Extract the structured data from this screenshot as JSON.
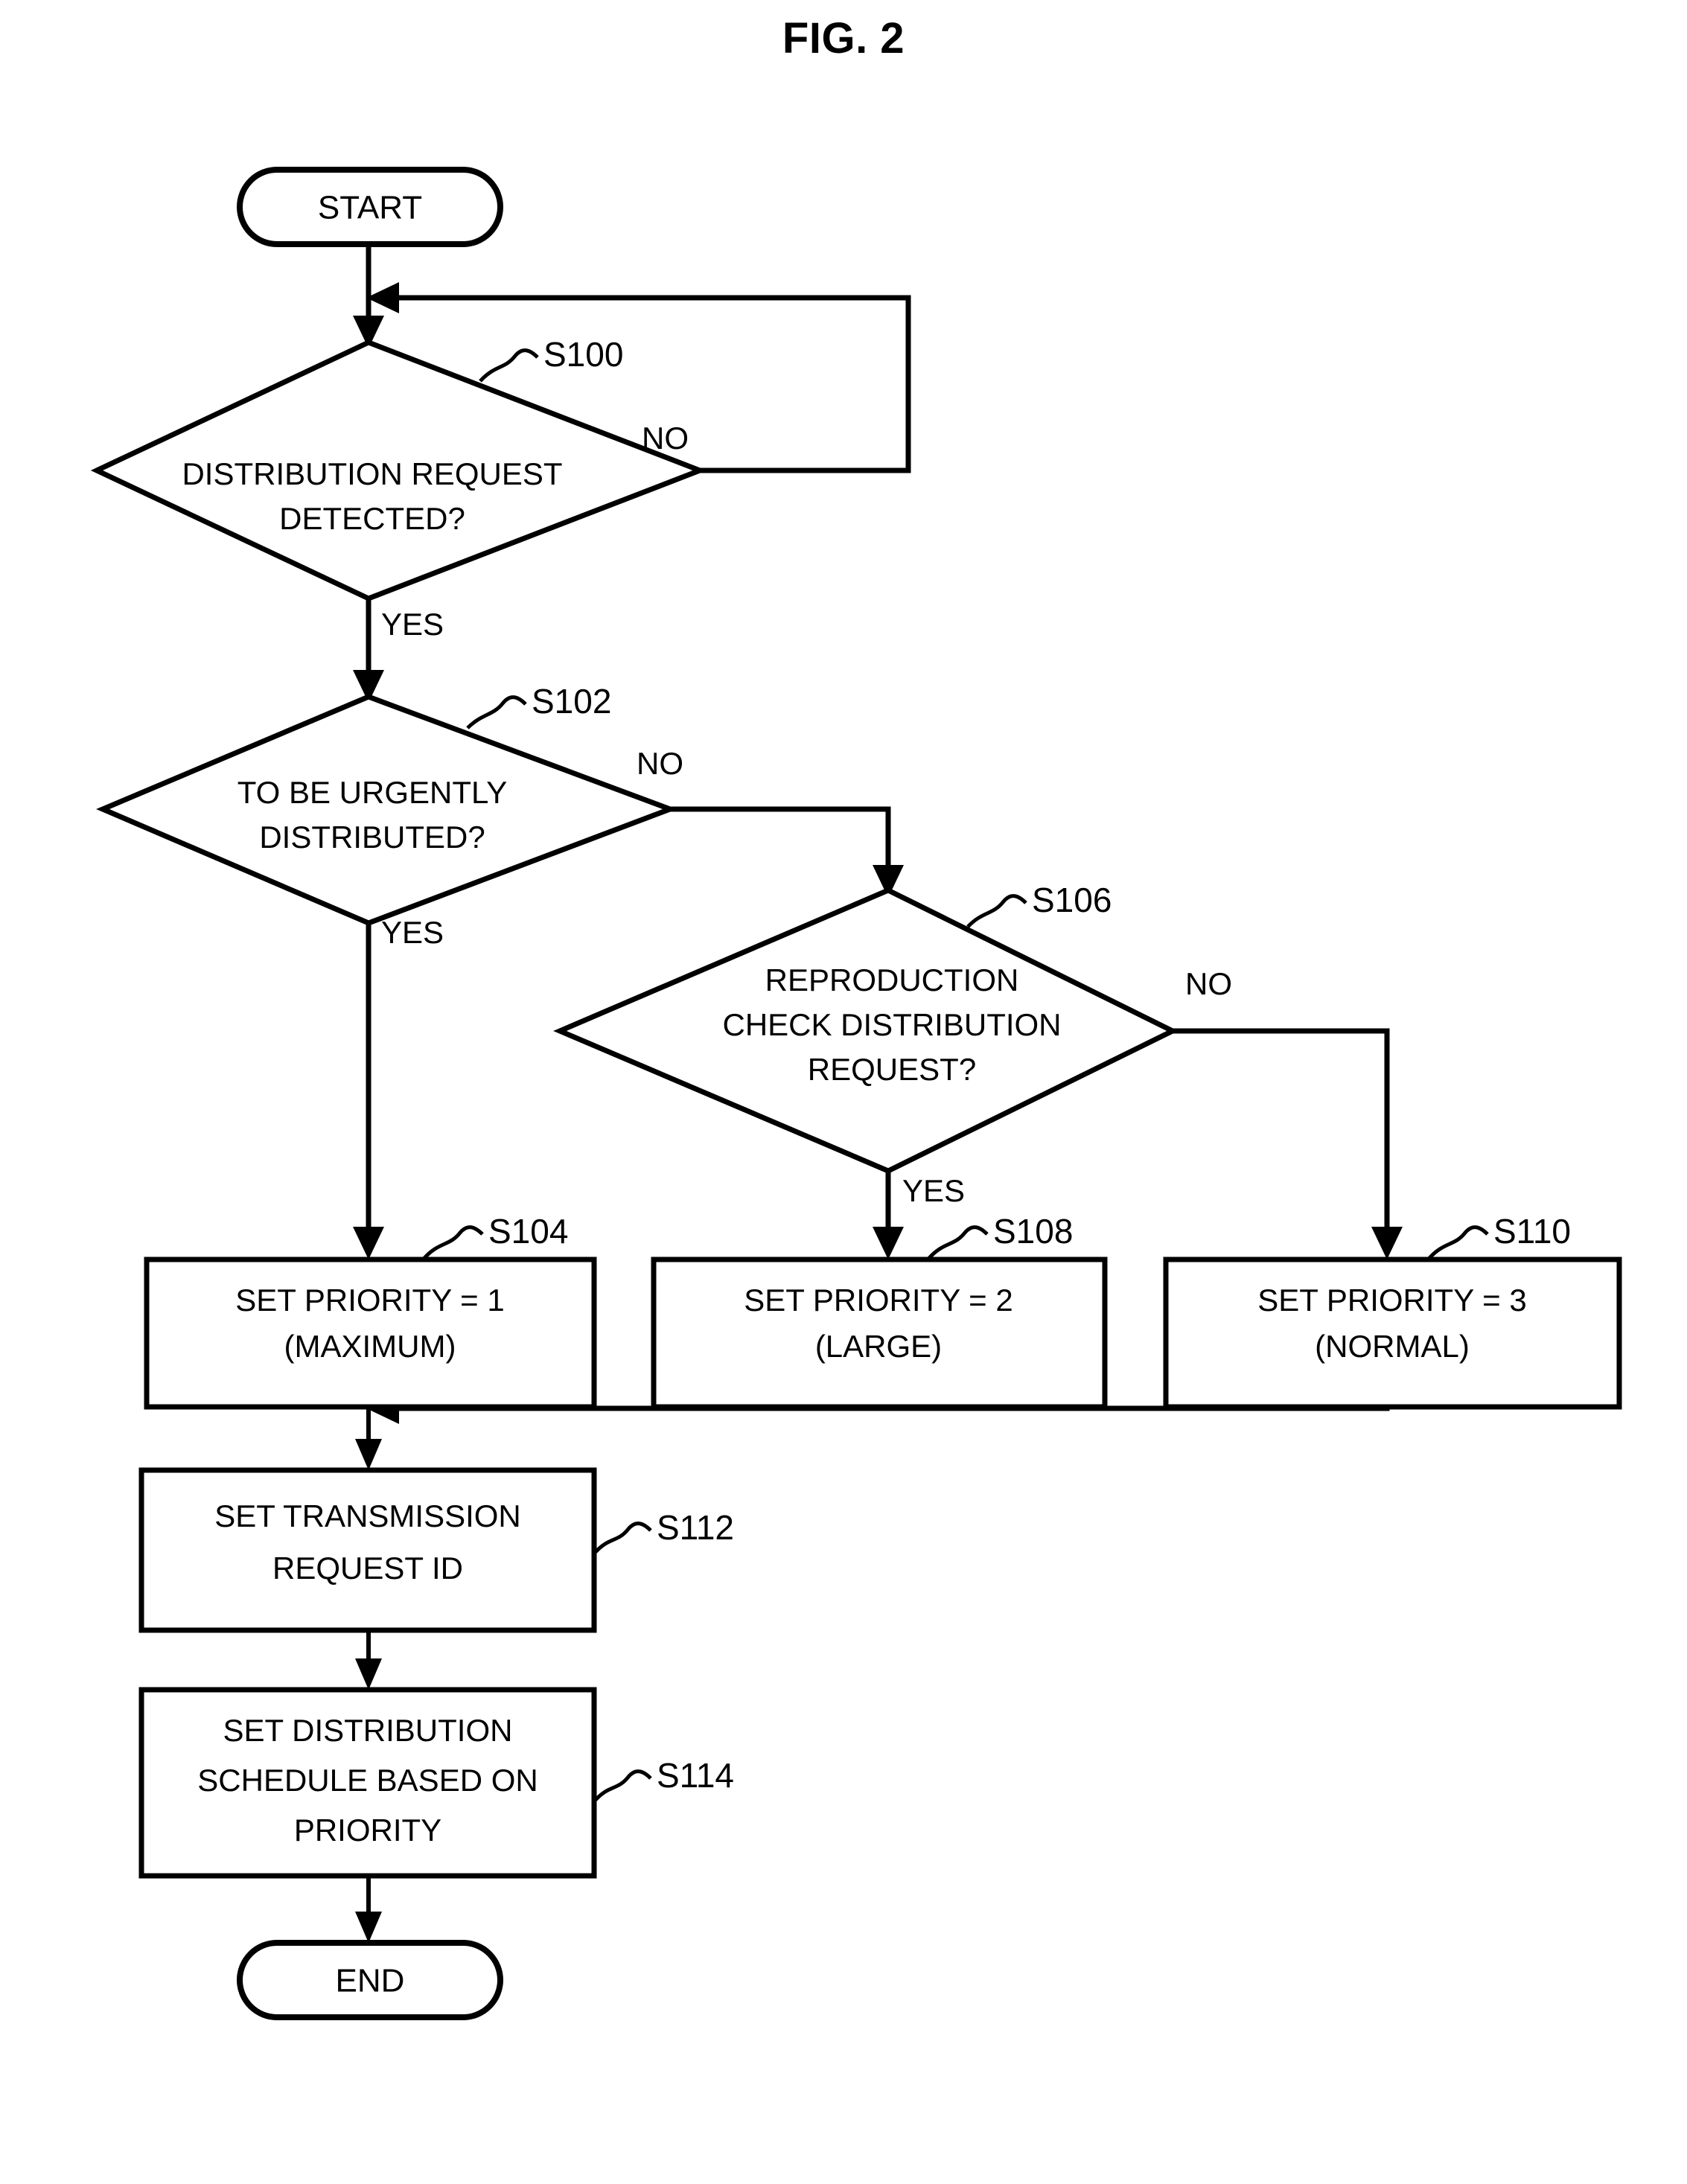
{
  "figure": {
    "title": "FIG. 2",
    "type": "flowchart"
  },
  "chart_data": {
    "type": "diagram",
    "title": "FIG. 2",
    "nodes": [
      {
        "id": "start",
        "shape": "terminator",
        "lines": [
          "START"
        ]
      },
      {
        "id": "s100",
        "shape": "decision",
        "step": "S100",
        "lines": [
          "DISTRIBUTION REQUEST",
          "DETECTED?"
        ]
      },
      {
        "id": "s102",
        "shape": "decision",
        "step": "S102",
        "lines": [
          "TO BE URGENTLY",
          "DISTRIBUTED?"
        ]
      },
      {
        "id": "s106",
        "shape": "decision",
        "step": "S106",
        "lines": [
          "REPRODUCTION",
          "CHECK DISTRIBUTION",
          "REQUEST?"
        ]
      },
      {
        "id": "s104",
        "shape": "process",
        "step": "S104",
        "lines": [
          "SET PRIORITY = 1",
          "(MAXIMUM)"
        ]
      },
      {
        "id": "s108",
        "shape": "process",
        "step": "S108",
        "lines": [
          "SET PRIORITY = 2",
          "(LARGE)"
        ]
      },
      {
        "id": "s110",
        "shape": "process",
        "step": "S110",
        "lines": [
          "SET PRIORITY = 3",
          "(NORMAL)"
        ]
      },
      {
        "id": "s112",
        "shape": "process",
        "step": "S112",
        "lines": [
          "SET TRANSMISSION",
          "REQUEST ID"
        ]
      },
      {
        "id": "s114",
        "shape": "process",
        "step": "S114",
        "lines": [
          "SET DISTRIBUTION",
          "SCHEDULE BASED ON",
          "PRIORITY"
        ]
      },
      {
        "id": "end",
        "shape": "terminator",
        "lines": [
          "END"
        ]
      }
    ],
    "edges": [
      {
        "from": "start",
        "to": "s100",
        "label": ""
      },
      {
        "from": "s100",
        "to": "s100",
        "label": "NO"
      },
      {
        "from": "s100",
        "to": "s102",
        "label": "YES"
      },
      {
        "from": "s102",
        "to": "s104",
        "label": "YES"
      },
      {
        "from": "s102",
        "to": "s106",
        "label": "NO"
      },
      {
        "from": "s106",
        "to": "s108",
        "label": "YES"
      },
      {
        "from": "s106",
        "to": "s110",
        "label": "NO"
      },
      {
        "from": "s104",
        "to": "s112",
        "label": ""
      },
      {
        "from": "s108",
        "to": "s112",
        "label": ""
      },
      {
        "from": "s110",
        "to": "s112",
        "label": ""
      },
      {
        "from": "s112",
        "to": "s114",
        "label": ""
      },
      {
        "from": "s114",
        "to": "end",
        "label": ""
      }
    ]
  },
  "nodes": {
    "start": {
      "text": "START"
    },
    "end": {
      "text": "END"
    },
    "s100": {
      "step": "S100",
      "line1": "DISTRIBUTION REQUEST",
      "line2": "DETECTED?"
    },
    "s102": {
      "step": "S102",
      "line1": "TO BE URGENTLY",
      "line2": "DISTRIBUTED?"
    },
    "s106": {
      "step": "S106",
      "line1": "REPRODUCTION",
      "line2": "CHECK DISTRIBUTION",
      "line3": "REQUEST?"
    },
    "s104": {
      "step": "S104",
      "line1": "SET PRIORITY = 1",
      "line2": "(MAXIMUM)"
    },
    "s108": {
      "step": "S108",
      "line1": "SET PRIORITY = 2",
      "line2": "(LARGE)"
    },
    "s110": {
      "step": "S110",
      "line1": "SET PRIORITY = 3",
      "line2": "(NORMAL)"
    },
    "s112": {
      "step": "S112",
      "line1": "SET TRANSMISSION",
      "line2": "REQUEST ID"
    },
    "s114": {
      "step": "S114",
      "line1": "SET DISTRIBUTION",
      "line2": "SCHEDULE BASED ON",
      "line3": "PRIORITY"
    }
  },
  "edge_labels": {
    "s100_no": "NO",
    "s100_yes": "YES",
    "s102_no": "NO",
    "s102_yes": "YES",
    "s106_no": "NO",
    "s106_yes": "YES"
  },
  "colors": {
    "stroke": "#000000",
    "fill": "#ffffff",
    "text": "#000000"
  }
}
